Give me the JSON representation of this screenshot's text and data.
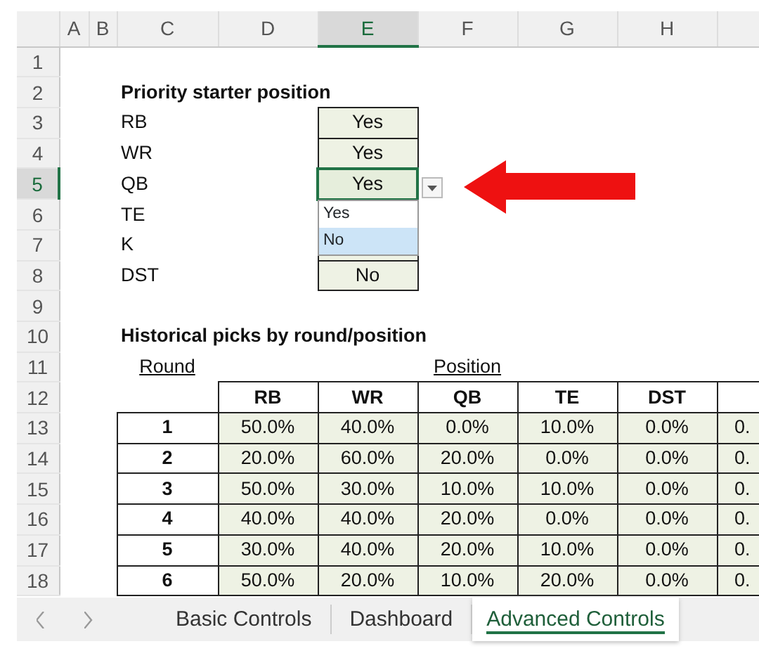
{
  "column_headers": [
    {
      "label": "A",
      "selected": false
    },
    {
      "label": "B",
      "selected": false
    },
    {
      "label": "C",
      "selected": false
    },
    {
      "label": "D",
      "selected": false
    },
    {
      "label": "E",
      "selected": true
    },
    {
      "label": "F",
      "selected": false
    },
    {
      "label": "G",
      "selected": false
    },
    {
      "label": "H",
      "selected": false
    }
  ],
  "row_numbers": [
    {
      "label": "1",
      "selected": false
    },
    {
      "label": "2",
      "selected": false
    },
    {
      "label": "3",
      "selected": false
    },
    {
      "label": "4",
      "selected": false
    },
    {
      "label": "5",
      "selected": true
    },
    {
      "label": "6",
      "selected": false
    },
    {
      "label": "7",
      "selected": false
    },
    {
      "label": "8",
      "selected": false
    },
    {
      "label": "9",
      "selected": false
    },
    {
      "label": "10",
      "selected": false
    },
    {
      "label": "11",
      "selected": false
    },
    {
      "label": "12",
      "selected": false
    },
    {
      "label": "13",
      "selected": false
    },
    {
      "label": "14",
      "selected": false
    },
    {
      "label": "15",
      "selected": false
    },
    {
      "label": "16",
      "selected": false
    },
    {
      "label": "17",
      "selected": false
    },
    {
      "label": "18",
      "selected": false
    }
  ],
  "priority": {
    "title": "Priority starter position",
    "rows": [
      {
        "position": "RB",
        "value": "Yes",
        "selected": false
      },
      {
        "position": "WR",
        "value": "Yes",
        "selected": false
      },
      {
        "position": "QB",
        "value": "Yes",
        "selected": true
      },
      {
        "position": "TE",
        "selected": false
      },
      {
        "position": "K",
        "selected": false
      },
      {
        "position": "DST",
        "value": "No",
        "selected": false
      }
    ]
  },
  "dropdown": {
    "options": [
      {
        "label": "Yes",
        "selected": false
      },
      {
        "label": "No",
        "selected": true
      }
    ]
  },
  "history": {
    "title": "Historical picks by round/position",
    "round_label": "Round",
    "position_label": "Position",
    "columns": [
      "RB",
      "WR",
      "QB",
      "TE",
      "DST"
    ],
    "rows": [
      {
        "round": "1",
        "values": [
          "50.0%",
          "40.0%",
          "0.0%",
          "10.0%",
          "0.0%",
          "0."
        ]
      },
      {
        "round": "2",
        "values": [
          "20.0%",
          "60.0%",
          "20.0%",
          "0.0%",
          "0.0%",
          "0."
        ]
      },
      {
        "round": "3",
        "values": [
          "50.0%",
          "30.0%",
          "10.0%",
          "10.0%",
          "0.0%",
          "0."
        ]
      },
      {
        "round": "4",
        "values": [
          "40.0%",
          "40.0%",
          "20.0%",
          "0.0%",
          "0.0%",
          "0."
        ]
      },
      {
        "round": "5",
        "values": [
          "30.0%",
          "40.0%",
          "20.0%",
          "10.0%",
          "0.0%",
          "0."
        ]
      },
      {
        "round": "6",
        "values": [
          "50.0%",
          "20.0%",
          "10.0%",
          "20.0%",
          "0.0%",
          "0."
        ]
      }
    ]
  },
  "sheet_tabs": [
    {
      "label": "Basic Controls",
      "selected": false
    },
    {
      "label": "Dashboard",
      "selected": false
    },
    {
      "label": "Advanced Controls",
      "selected": true
    }
  ]
}
